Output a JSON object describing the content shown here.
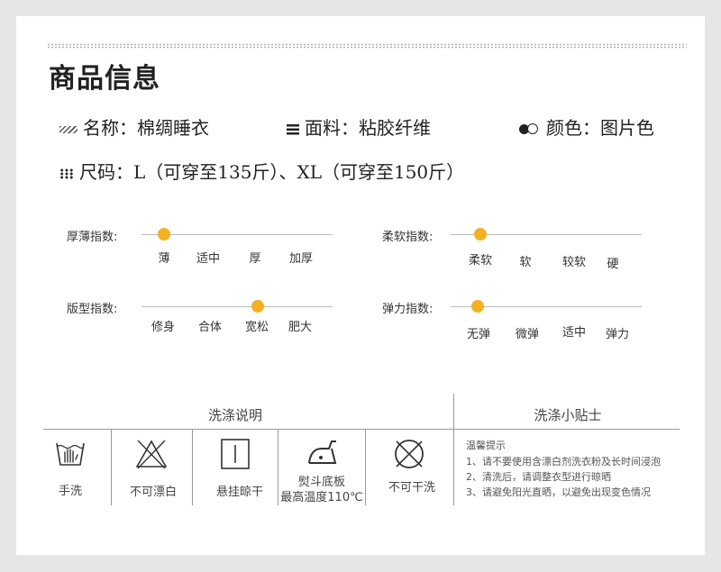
{
  "title": "商品信息",
  "info": {
    "name": "名称：棉绸睡衣",
    "fabric": "面料：粘胶纤维",
    "color": "颜色：图片色",
    "size": "尺码：L（可穿至135斤）、XL（可穿至150斤）"
  },
  "scales": [
    {
      "label": "厚薄指数:",
      "options": [
        "薄",
        "适中",
        "厚",
        "加厚"
      ],
      "selected": 0
    },
    {
      "label": "柔软指数:",
      "options": [
        "柔软",
        "软",
        "较软",
        "硬"
      ],
      "selected": 0
    },
    {
      "label": "版型指数:",
      "options": [
        "修身",
        "合体",
        "宽松",
        "肥大"
      ],
      "selected": 2
    },
    {
      "label": "弹力指数:",
      "options": [
        "无弹",
        "微弹",
        "适中",
        "弹力"
      ],
      "selected": 0
    }
  ],
  "care": {
    "title": "洗涤说明",
    "items": [
      "手洗",
      "不可漂白",
      "悬挂晾干",
      "熨斗底板",
      "最高温度110℃",
      "不可干洗"
    ]
  },
  "tips": {
    "title": "洗涤小贴士",
    "heading": "温馨提示",
    "lines": [
      "1、请不要使用含漂白剂洗衣粉及长时间浸泡",
      "2、清洗后，请调整衣型进行晾晒",
      "3、请避免阳光直晒，以避免出现变色情况"
    ]
  },
  "colors": {
    "accent": "#f3b021"
  },
  "icons": [
    "hatch-icon",
    "lines-icon",
    "color-circles-icon",
    "dots-grid-icon",
    "hand-wash-icon",
    "no-bleach-icon",
    "hang-dry-icon",
    "iron-icon",
    "no-dry-clean-icon"
  ]
}
